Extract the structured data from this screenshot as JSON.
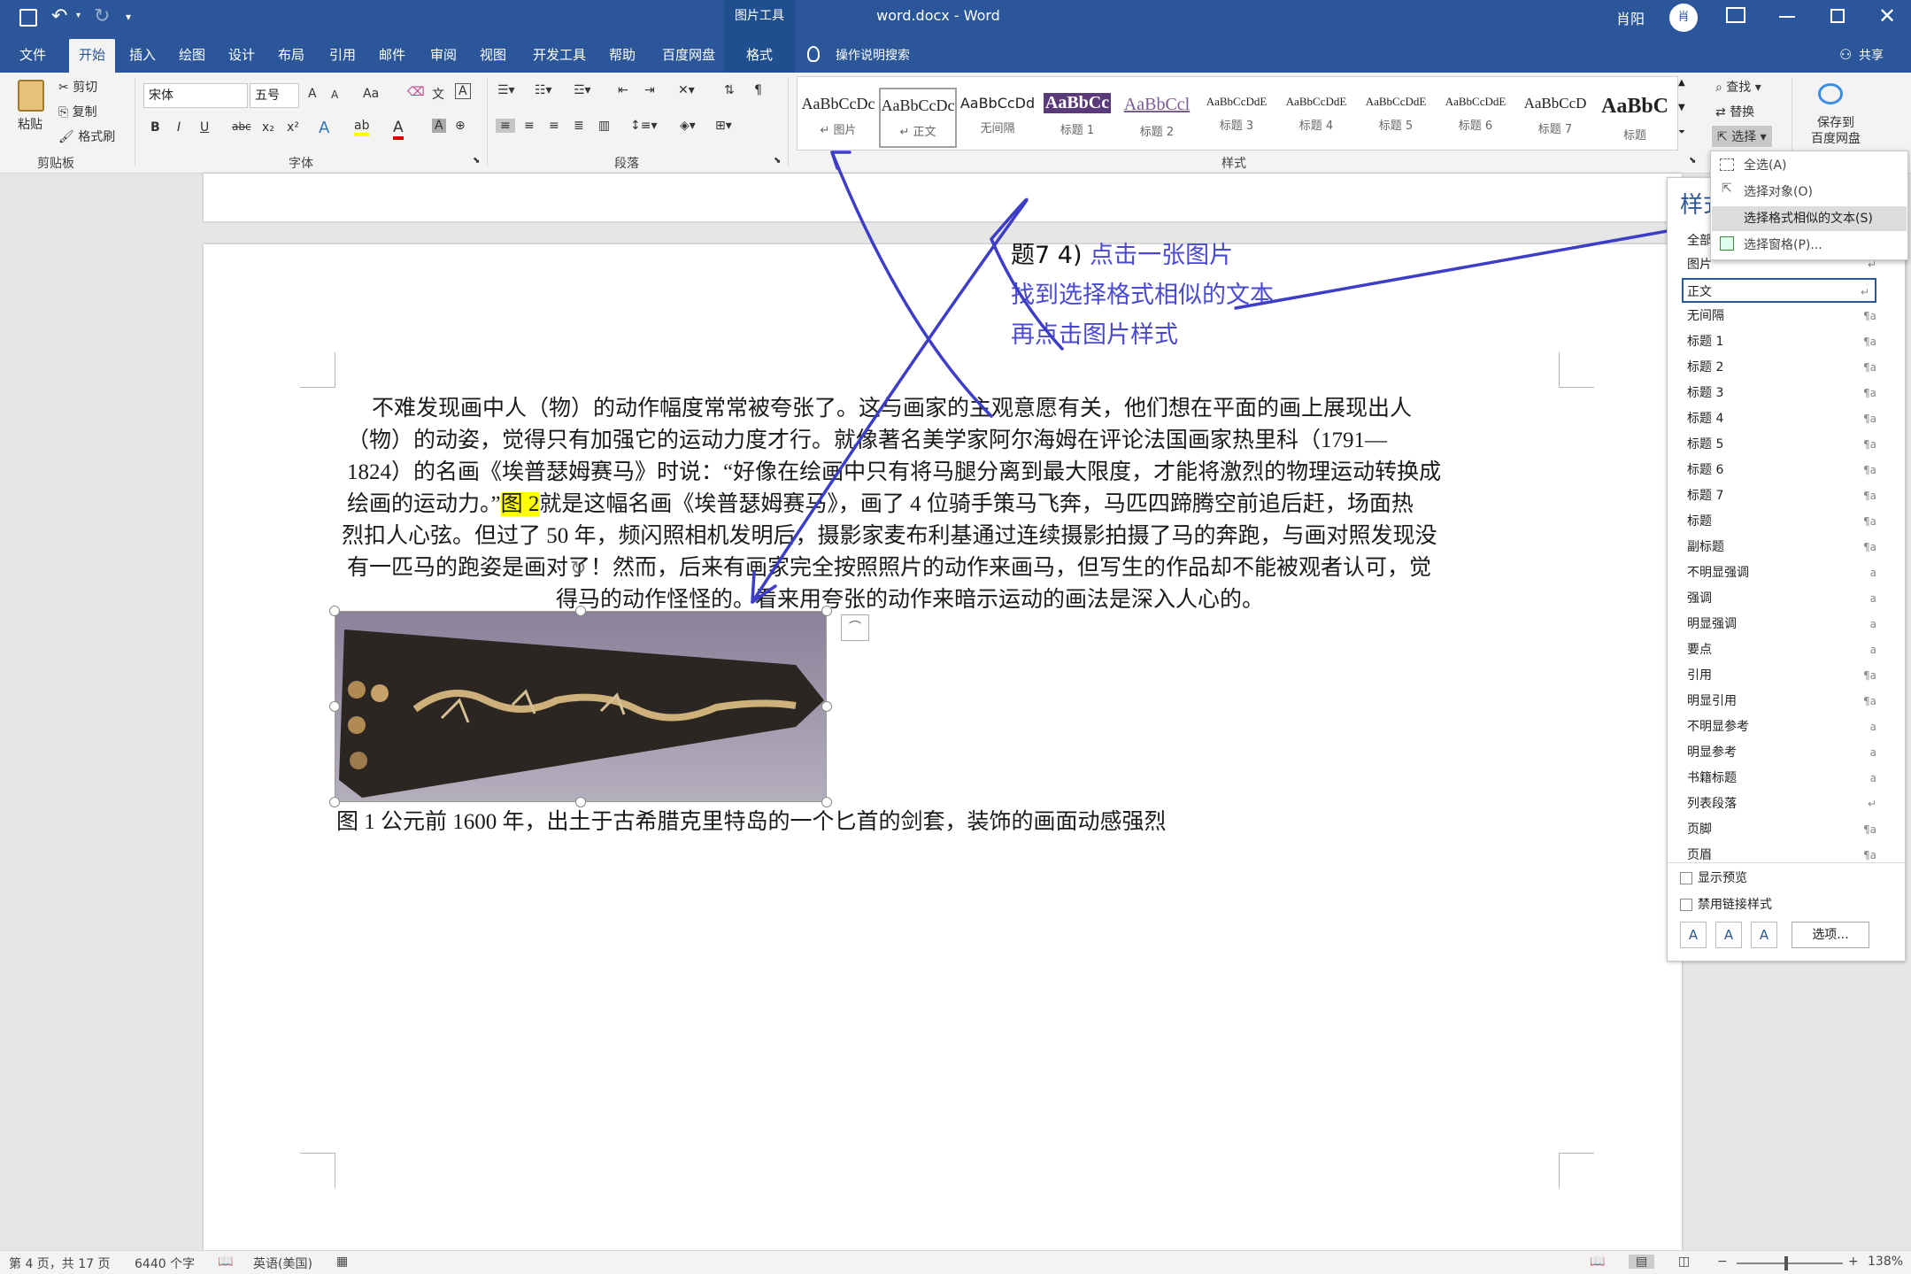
{
  "titlebar": {
    "doc_title": "word.docx  -  Word",
    "tool_context": "图片工具",
    "user": "肖阳",
    "avatar_text": "肖"
  },
  "tabs": [
    "文件",
    "开始",
    "插入",
    "绘图",
    "设计",
    "布局",
    "引用",
    "邮件",
    "审阅",
    "视图",
    "开发工具",
    "帮助",
    "百度网盘",
    "格式"
  ],
  "tell_me": "操作说明搜索",
  "share": "共享",
  "ribbon": {
    "clipboard": {
      "paste": "粘贴",
      "cut": "剪切",
      "copy": "复制",
      "format_painter": "格式刷",
      "label": "剪贴板"
    },
    "font": {
      "name": "宋体",
      "size": "五号",
      "label": "字体",
      "bold": "B",
      "italic": "I",
      "underline": "U",
      "strike": "abc",
      "sub": "x₂",
      "sup": "x²",
      "grow": "A",
      "shrink": "A",
      "case": "Aa",
      "color_a": "A"
    },
    "paragraph": {
      "label": "段落"
    },
    "styles": {
      "label": "样式",
      "items": [
        {
          "preview": "AaBbCcDc",
          "name": "↵ 图片"
        },
        {
          "preview": "AaBbCcDc",
          "name": "↵ 正文"
        },
        {
          "preview": "AaBbCcDd",
          "name": "无间隔"
        },
        {
          "preview": "AaBbCc",
          "name": "标题 1"
        },
        {
          "preview": "AaBbCcl",
          "name": "标题 2"
        },
        {
          "preview": "AaBbCcDdE",
          "name": "标题 3"
        },
        {
          "preview": "AaBbCcDdE",
          "name": "标题 4"
        },
        {
          "preview": "AaBbCcDdE",
          "name": "标题 5"
        },
        {
          "preview": "AaBbCcDdE",
          "name": "标题 6"
        },
        {
          "preview": "AaBbCcD",
          "name": "标题 7"
        },
        {
          "preview": "AaBbC",
          "name": "标题"
        }
      ]
    },
    "editing": {
      "find": "查找",
      "replace": "替换",
      "select": "选择"
    },
    "baidu": {
      "save": "保存到",
      "save2": "百度网盘"
    }
  },
  "select_menu": [
    "全选(A)",
    "选择对象(O)",
    "选择格式相似的文本(S)",
    "选择窗格(P)..."
  ],
  "style_pane": {
    "title": "样式",
    "all": "全部",
    "items": [
      {
        "name": "图片",
        "mark": "↵"
      },
      {
        "name": "正文",
        "mark": "↵"
      },
      {
        "name": "无间隔",
        "mark": "¶a"
      },
      {
        "name": "标题 1",
        "mark": "¶a"
      },
      {
        "name": "标题 2",
        "mark": "¶a"
      },
      {
        "name": "标题 3",
        "mark": "¶a"
      },
      {
        "name": "标题 4",
        "mark": "¶a"
      },
      {
        "name": "标题 5",
        "mark": "¶a"
      },
      {
        "name": "标题 6",
        "mark": "¶a"
      },
      {
        "name": "标题 7",
        "mark": "¶a"
      },
      {
        "name": "标题",
        "mark": "¶a"
      },
      {
        "name": "副标题",
        "mark": "¶a"
      },
      {
        "name": "不明显强调",
        "mark": "a"
      },
      {
        "name": "强调",
        "mark": "a"
      },
      {
        "name": "明显强调",
        "mark": "a"
      },
      {
        "name": "要点",
        "mark": "a"
      },
      {
        "name": "引用",
        "mark": "¶a"
      },
      {
        "name": "明显引用",
        "mark": "¶a"
      },
      {
        "name": "不明显参考",
        "mark": "a"
      },
      {
        "name": "明显参考",
        "mark": "a"
      },
      {
        "name": "书籍标题",
        "mark": "a"
      },
      {
        "name": "列表段落",
        "mark": "↵"
      },
      {
        "name": "页脚",
        "mark": "¶a"
      },
      {
        "name": "页眉",
        "mark": "¶a"
      }
    ],
    "show_preview": "显示预览",
    "disable_linked": "禁用链接样式",
    "options_button": "选项..."
  },
  "annotation": {
    "line1a": "题7 4)",
    "line1b": "点击一张图片",
    "line2": "找到选择格式相似的文本",
    "line3": "再点击图片样式"
  },
  "document": {
    "lines": [
      "不难发现画中人（物）的动作幅度常常被夸张了。这与画家的主观意愿有关，他们想在平面的画上展现出人",
      "（物）的动姿，觉得只有加强它的运动力度才行。就像著名美学家阿尔海姆在评论法国画家热里科（1791—",
      "1824）的名画《埃普瑟姆赛马》时说：“好像在绘画中只有将马腿分离到最大限度，才能将激烈的物理运动转换成",
      "就是这幅名画《埃普瑟姆赛马》，画了 4 位骑手策马飞奔，马匹四蹄腾空前追后赶，场面热",
      "烈扣人心弦。但过了 50 年，频闪照相机发明后，摄影家麦布利基通过连续摄影拍摄了马的奔跑，与画对照发现没",
      "有一匹马的跑姿是画对了！然而，后来有画家完全按照照片的动作来画马，但写生的作品却不能被观者认可，觉",
      "得马的动作怪怪的。看来用夸张的动作来暗示运动的画法是深入人心的。"
    ],
    "line4_prefix": "绘画的运动力。”",
    "highlight": "图 2",
    "caption": "图 1 公元前 1600 年，出土于古希腊克里特岛的一个匕首的剑套，装饰的画面动感强烈"
  },
  "status": {
    "page": "第 4 页，共 17 页",
    "words": "6440 个字",
    "lang": "英语(美国)",
    "zoom": "138%"
  }
}
